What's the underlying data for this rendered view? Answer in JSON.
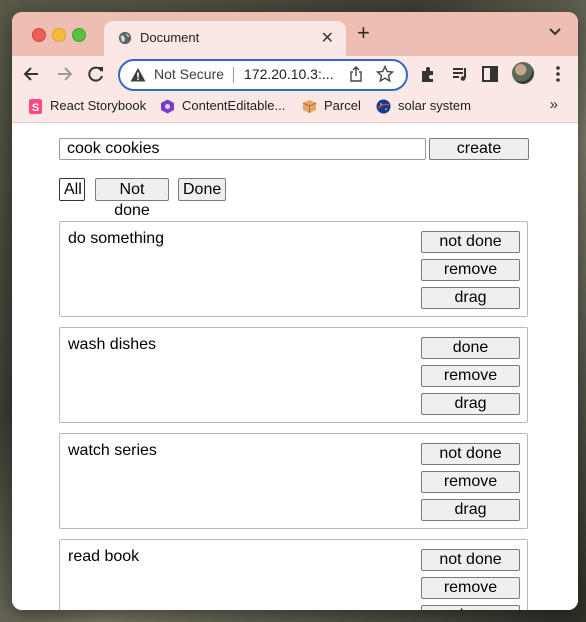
{
  "browser": {
    "tab": {
      "title": "Document"
    },
    "address": {
      "security_label": "Not Secure",
      "url": "172.20.10.3:..."
    },
    "bookmarks": [
      {
        "label": "React Storybook",
        "icon": "storybook-icon",
        "color": "#ff4785"
      },
      {
        "label": "ContentEditable...",
        "icon": "contenteditable-icon",
        "color": "#7a3cc9"
      },
      {
        "label": "Parcel",
        "icon": "parcel-icon",
        "color": "#e7a56b"
      },
      {
        "label": "solar system",
        "icon": "nasa-icon",
        "color": "#0b3d91"
      }
    ],
    "bookmarks_overflow": "»"
  },
  "app": {
    "new_todo_value": "cook cookies",
    "create_label": "create",
    "filters": {
      "all": "All",
      "not_done": "Not done",
      "done": "Done",
      "selected": "All"
    },
    "todos": [
      {
        "text": "do something",
        "toggle_label": "not done",
        "remove_label": "remove",
        "drag_label": "drag"
      },
      {
        "text": "wash dishes",
        "toggle_label": "done",
        "remove_label": "remove",
        "drag_label": "drag"
      },
      {
        "text": "watch series",
        "toggle_label": "not done",
        "remove_label": "remove",
        "drag_label": "drag"
      },
      {
        "text": "read book",
        "toggle_label": "not done",
        "remove_label": "remove",
        "drag_label": "drag"
      }
    ]
  },
  "colors": {
    "chrome_frame": "#eebeb2",
    "chrome_toolbar": "#fbe8e4",
    "omnibox_border": "#3367c8"
  }
}
